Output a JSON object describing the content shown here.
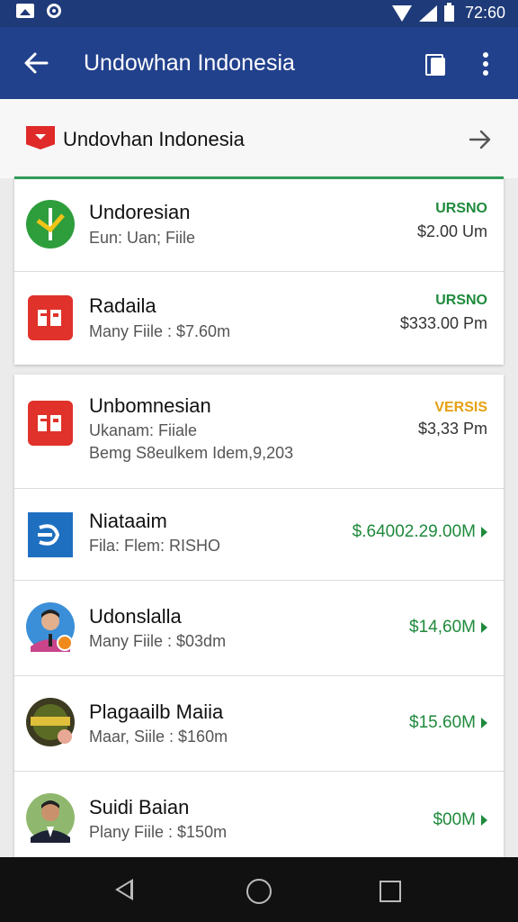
{
  "status_bar": {
    "time": "72:60",
    "icons": [
      "image-icon",
      "circle-icon",
      "wifi-icon",
      "signal-icon",
      "battery-icon"
    ]
  },
  "app_bar": {
    "title": "Undowhan Indonesia",
    "back_icon": "arrow-left-icon",
    "actions": [
      "copy-icon",
      "more-vert-icon"
    ]
  },
  "section": {
    "title": "Undovhan Indonesia",
    "icon": "flag-icon",
    "arrow_icon": "arrow-right-icon"
  },
  "colors": {
    "app_bar": "#22418c",
    "status_bar": "#1f3a78",
    "accent_green": "#1f8a3c",
    "tag_orange": "#e6a012",
    "section_underline": "#2e9b59"
  },
  "card1": {
    "rows": [
      {
        "title": "Undoresian",
        "subtitle": "Eun: Uan; Fiile",
        "tag": "URSNO",
        "amount": "$2.00 Um",
        "icon": "green-check-logo-icon"
      },
      {
        "title": "Radaila",
        "subtitle": "Many Fiile : $7.60m",
        "tag": "URSNO",
        "amount": "$333.00 Pm",
        "icon": "red-ep-logo-icon"
      }
    ]
  },
  "card2": {
    "rows": [
      {
        "title": "Unbomnesian",
        "subtitle": "Ukanam: Fiiale",
        "subtitle2": "Bemg S8eulkem Idem,9,203",
        "tag": "VERSIS",
        "amount": "$3,33 Pm",
        "icon": "red-ep-logo-icon"
      },
      {
        "title": "Niataaim",
        "subtitle": "Fila: Flem: RISHO",
        "amount": "$.64002.29.00M",
        "icon": "blue-d-logo-icon"
      },
      {
        "title": "Udonslalla",
        "subtitle": "Many Fiile : $03dm",
        "amount": "$14,60M",
        "icon": "avatar-man-icon"
      },
      {
        "title": "Plagaailb Maiia",
        "subtitle": "Maar, Siile : $160m",
        "amount": "$15.60M",
        "icon": "avatar-logo-icon"
      },
      {
        "title": "Suidi Baian",
        "subtitle": "Plany Fiile : $150m",
        "amount": "$00M",
        "icon": "avatar-man2-icon"
      }
    ]
  },
  "nav_bar": {
    "icons": [
      "nav-back-icon",
      "nav-home-icon",
      "nav-recents-icon"
    ]
  }
}
